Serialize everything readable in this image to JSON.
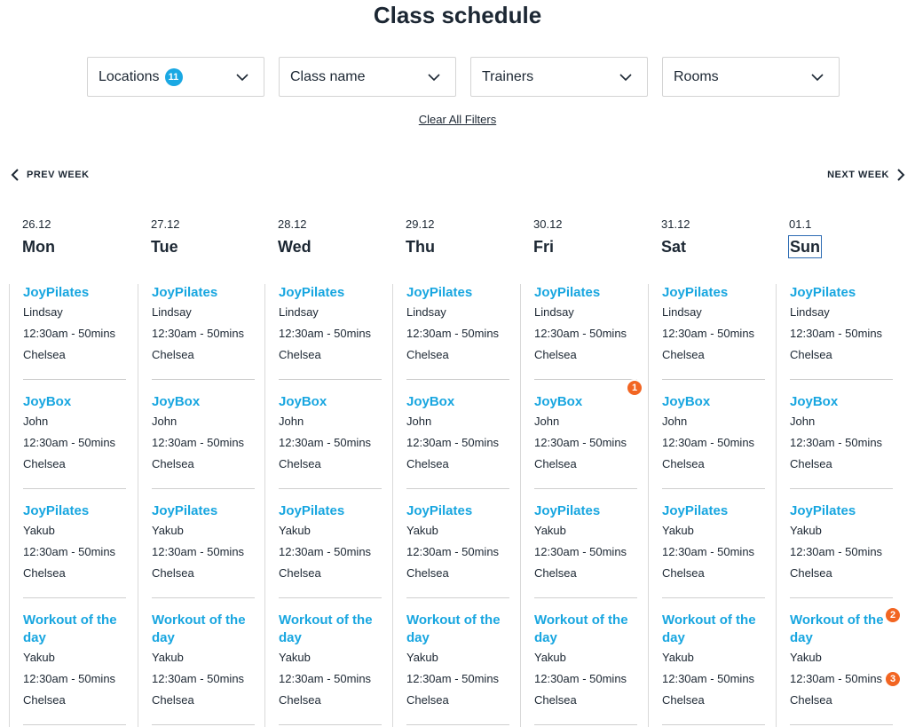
{
  "page_title": "Class schedule",
  "filters": [
    {
      "label": "Locations",
      "count": "11"
    },
    {
      "label": "Class name",
      "count": null
    },
    {
      "label": "Trainers",
      "count": null
    },
    {
      "label": "Rooms",
      "count": null
    }
  ],
  "clear_filters_label": "Clear All Filters",
  "nav": {
    "prev_label": "PREV WEEK",
    "next_label": "NEXT WEEK"
  },
  "days": [
    {
      "date": "26.12",
      "name": "Mon"
    },
    {
      "date": "27.12",
      "name": "Tue"
    },
    {
      "date": "28.12",
      "name": "Wed"
    },
    {
      "date": "29.12",
      "name": "Thu"
    },
    {
      "date": "30.12",
      "name": "Fri"
    },
    {
      "date": "31.12",
      "name": "Sat"
    },
    {
      "date": "01.1",
      "name": "Sun",
      "selected": true
    }
  ],
  "classes": [
    {
      "name": "JoyPilates",
      "trainer": "Lindsay",
      "time": "12:30am - 50mins",
      "location": "Chelsea"
    },
    {
      "name": "JoyBox",
      "trainer": "John",
      "time": "12:30am - 50mins",
      "location": "Chelsea"
    },
    {
      "name": "JoyPilates",
      "trainer": "Yakub",
      "time": "12:30am - 50mins",
      "location": "Chelsea"
    },
    {
      "name": "Workout of the day",
      "trainer": "Yakub",
      "time": "12:30am - 50mins",
      "location": "Chelsea"
    }
  ],
  "badges": [
    "1",
    "2",
    "3"
  ],
  "colors": {
    "accent": "#18a6e0",
    "badge": "#f26522",
    "count_badge": "#1aa8e3",
    "text": "#1c2733"
  }
}
